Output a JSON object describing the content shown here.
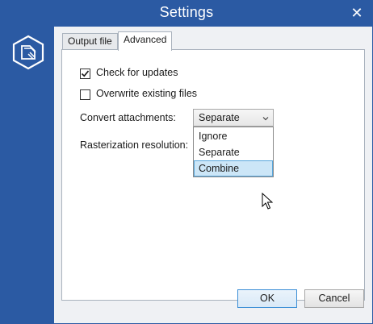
{
  "window": {
    "title": "Settings",
    "close_glyph": "✕"
  },
  "app_icon": "document-folder-icon",
  "tabs": [
    {
      "label": "Output file",
      "active": false
    },
    {
      "label": "Advanced",
      "active": true
    }
  ],
  "advanced": {
    "check_updates": {
      "label": "Check for updates",
      "checked": true
    },
    "overwrite": {
      "label": "Overwrite existing files",
      "checked": false
    },
    "convert_attachments": {
      "label": "Convert attachments:",
      "selected": "Separate",
      "options": [
        "Ignore",
        "Separate",
        "Combine"
      ],
      "hovered": "Combine"
    },
    "rasterization": {
      "label": "Rasterization resolution:"
    }
  },
  "buttons": {
    "ok": "OK",
    "cancel": "Cancel"
  },
  "colors": {
    "titlebar": "#2b5aa3",
    "hover_bg": "#cce6f7",
    "hover_border": "#58a6db"
  }
}
